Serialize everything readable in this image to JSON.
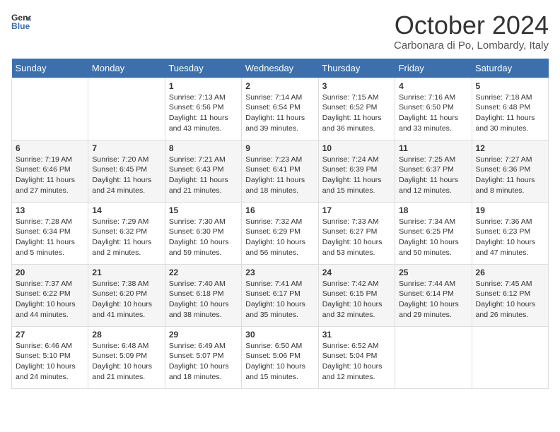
{
  "header": {
    "logo_line1": "General",
    "logo_line2": "Blue",
    "month": "October 2024",
    "location": "Carbonara di Po, Lombardy, Italy"
  },
  "days_of_week": [
    "Sunday",
    "Monday",
    "Tuesday",
    "Wednesday",
    "Thursday",
    "Friday",
    "Saturday"
  ],
  "weeks": [
    [
      {
        "day": "",
        "info": ""
      },
      {
        "day": "",
        "info": ""
      },
      {
        "day": "1",
        "info": "Sunrise: 7:13 AM\nSunset: 6:56 PM\nDaylight: 11 hours and 43 minutes."
      },
      {
        "day": "2",
        "info": "Sunrise: 7:14 AM\nSunset: 6:54 PM\nDaylight: 11 hours and 39 minutes."
      },
      {
        "day": "3",
        "info": "Sunrise: 7:15 AM\nSunset: 6:52 PM\nDaylight: 11 hours and 36 minutes."
      },
      {
        "day": "4",
        "info": "Sunrise: 7:16 AM\nSunset: 6:50 PM\nDaylight: 11 hours and 33 minutes."
      },
      {
        "day": "5",
        "info": "Sunrise: 7:18 AM\nSunset: 6:48 PM\nDaylight: 11 hours and 30 minutes."
      }
    ],
    [
      {
        "day": "6",
        "info": "Sunrise: 7:19 AM\nSunset: 6:46 PM\nDaylight: 11 hours and 27 minutes."
      },
      {
        "day": "7",
        "info": "Sunrise: 7:20 AM\nSunset: 6:45 PM\nDaylight: 11 hours and 24 minutes."
      },
      {
        "day": "8",
        "info": "Sunrise: 7:21 AM\nSunset: 6:43 PM\nDaylight: 11 hours and 21 minutes."
      },
      {
        "day": "9",
        "info": "Sunrise: 7:23 AM\nSunset: 6:41 PM\nDaylight: 11 hours and 18 minutes."
      },
      {
        "day": "10",
        "info": "Sunrise: 7:24 AM\nSunset: 6:39 PM\nDaylight: 11 hours and 15 minutes."
      },
      {
        "day": "11",
        "info": "Sunrise: 7:25 AM\nSunset: 6:37 PM\nDaylight: 11 hours and 12 minutes."
      },
      {
        "day": "12",
        "info": "Sunrise: 7:27 AM\nSunset: 6:36 PM\nDaylight: 11 hours and 8 minutes."
      }
    ],
    [
      {
        "day": "13",
        "info": "Sunrise: 7:28 AM\nSunset: 6:34 PM\nDaylight: 11 hours and 5 minutes."
      },
      {
        "day": "14",
        "info": "Sunrise: 7:29 AM\nSunset: 6:32 PM\nDaylight: 11 hours and 2 minutes."
      },
      {
        "day": "15",
        "info": "Sunrise: 7:30 AM\nSunset: 6:30 PM\nDaylight: 10 hours and 59 minutes."
      },
      {
        "day": "16",
        "info": "Sunrise: 7:32 AM\nSunset: 6:29 PM\nDaylight: 10 hours and 56 minutes."
      },
      {
        "day": "17",
        "info": "Sunrise: 7:33 AM\nSunset: 6:27 PM\nDaylight: 10 hours and 53 minutes."
      },
      {
        "day": "18",
        "info": "Sunrise: 7:34 AM\nSunset: 6:25 PM\nDaylight: 10 hours and 50 minutes."
      },
      {
        "day": "19",
        "info": "Sunrise: 7:36 AM\nSunset: 6:23 PM\nDaylight: 10 hours and 47 minutes."
      }
    ],
    [
      {
        "day": "20",
        "info": "Sunrise: 7:37 AM\nSunset: 6:22 PM\nDaylight: 10 hours and 44 minutes."
      },
      {
        "day": "21",
        "info": "Sunrise: 7:38 AM\nSunset: 6:20 PM\nDaylight: 10 hours and 41 minutes."
      },
      {
        "day": "22",
        "info": "Sunrise: 7:40 AM\nSunset: 6:18 PM\nDaylight: 10 hours and 38 minutes."
      },
      {
        "day": "23",
        "info": "Sunrise: 7:41 AM\nSunset: 6:17 PM\nDaylight: 10 hours and 35 minutes."
      },
      {
        "day": "24",
        "info": "Sunrise: 7:42 AM\nSunset: 6:15 PM\nDaylight: 10 hours and 32 minutes."
      },
      {
        "day": "25",
        "info": "Sunrise: 7:44 AM\nSunset: 6:14 PM\nDaylight: 10 hours and 29 minutes."
      },
      {
        "day": "26",
        "info": "Sunrise: 7:45 AM\nSunset: 6:12 PM\nDaylight: 10 hours and 26 minutes."
      }
    ],
    [
      {
        "day": "27",
        "info": "Sunrise: 6:46 AM\nSunset: 5:10 PM\nDaylight: 10 hours and 24 minutes."
      },
      {
        "day": "28",
        "info": "Sunrise: 6:48 AM\nSunset: 5:09 PM\nDaylight: 10 hours and 21 minutes."
      },
      {
        "day": "29",
        "info": "Sunrise: 6:49 AM\nSunset: 5:07 PM\nDaylight: 10 hours and 18 minutes."
      },
      {
        "day": "30",
        "info": "Sunrise: 6:50 AM\nSunset: 5:06 PM\nDaylight: 10 hours and 15 minutes."
      },
      {
        "day": "31",
        "info": "Sunrise: 6:52 AM\nSunset: 5:04 PM\nDaylight: 10 hours and 12 minutes."
      },
      {
        "day": "",
        "info": ""
      },
      {
        "day": "",
        "info": ""
      }
    ]
  ]
}
